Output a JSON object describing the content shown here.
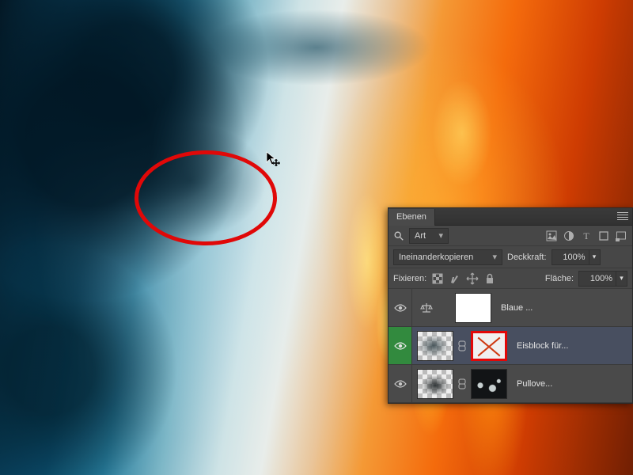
{
  "panel": {
    "tab_label": "Ebenen",
    "filter": {
      "kind_label": "Art"
    },
    "blend": {
      "mode": "Ineinanderkopieren",
      "opacity_label": "Deckkraft:",
      "opacity_value": "100%"
    },
    "lock": {
      "label": "Fixieren:",
      "fill_label": "Fläche:",
      "fill_value": "100%"
    },
    "layers": [
      {
        "name": "Blaue ...",
        "selected": false,
        "visible": true
      },
      {
        "name": "Eisblock für...",
        "selected": true,
        "visible": true
      },
      {
        "name": "Pullove...",
        "selected": false,
        "visible": true
      }
    ]
  },
  "icons": {
    "search": "search-icon",
    "chevron": "▾",
    "chevron_up": "▴"
  },
  "colors": {
    "annotation_red": "#e00808",
    "selection_green": "#328a3e",
    "panel_bg": "#4a4a4a",
    "selected_row": "#484f60"
  }
}
